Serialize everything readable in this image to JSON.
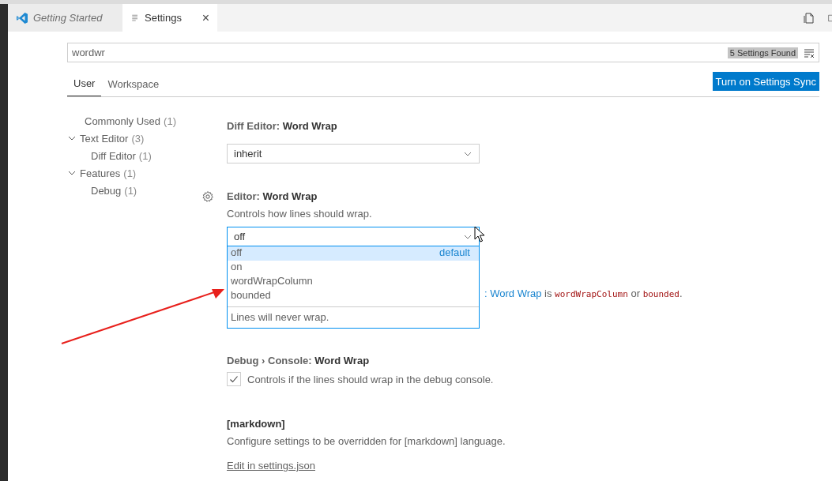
{
  "tabs": [
    {
      "label": "Getting Started",
      "selected": false,
      "preview": true
    },
    {
      "label": "Settings",
      "selected": true,
      "preview": false
    }
  ],
  "close_tab": "×",
  "search": {
    "value": "wordwr",
    "count": "5 Settings Found"
  },
  "scope_tabs": [
    {
      "label": "User",
      "selected": true
    },
    {
      "label": "Workspace",
      "selected": false
    }
  ],
  "sync_button": "Turn on Settings Sync",
  "toc": [
    {
      "label": "Commonly Used",
      "count": "(1)"
    },
    {
      "label": "Text Editor",
      "count": "(3)",
      "expanded": true,
      "children": [
        {
          "label": "Diff Editor",
          "count": "(1)"
        }
      ]
    },
    {
      "label": "Features",
      "count": "(1)",
      "expanded": true,
      "children": [
        {
          "label": "Debug",
          "count": "(1)"
        }
      ]
    }
  ],
  "settings": [
    {
      "kind": "select",
      "title": "Diff Editor: **Word Wrap**",
      "value": "inherit"
    },
    {
      "kind": "select",
      "title": "Editor: **Word Wrap**",
      "description": "Controls how lines should wrap.",
      "value": "off",
      "gear": true,
      "open": true,
      "options": [
        {
          "label": "off",
          "note": "default",
          "selected": true
        },
        {
          "label": "on",
          "selected": false
        },
        {
          "label": "wordWrapColumn",
          "selected": false
        },
        {
          "label": "bounded",
          "selected": false
        }
      ],
      "option_description": "Lines will never wrap."
    },
    {
      "kind": "covered",
      "segments": [
        {
          "kind": "link",
          "text": ": Word Wrap"
        },
        {
          "kind": "text",
          "text": " is "
        },
        {
          "kind": "code",
          "text": "wordWrapColumn"
        },
        {
          "kind": "text",
          "text": " or "
        },
        {
          "kind": "code",
          "text": "bounded"
        },
        {
          "kind": "text",
          "text": "."
        }
      ]
    },
    {
      "kind": "checkbox",
      "title": "Debug › Console: **Word Wrap**",
      "checked": true,
      "description": "Controls if the lines should wrap in the debug console."
    },
    {
      "kind": "override",
      "title": "[markdown]",
      "description": "Configure settings to be overridden for [markdown] language.",
      "link": "Edit in settings.json"
    }
  ]
}
